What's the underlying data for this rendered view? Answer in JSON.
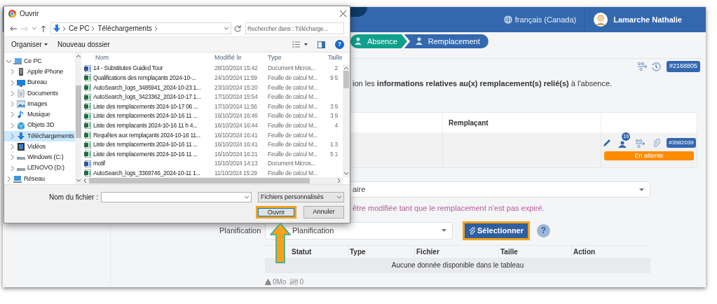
{
  "app": {
    "language": "français (Canada)",
    "user": "Lamarche Nathalie",
    "steps": [
      {
        "label": "Absence",
        "selected": false
      },
      {
        "label": "Remplacement",
        "selected": true
      }
    ],
    "record_id": "#2168805",
    "intro": "ion les **informations relatives au(x) remplacement(s) relié(s)** à l'absence.",
    "replacements": {
      "columns": [
        "Remplaçant"
      ],
      "row": {
        "candidates": "19",
        "id": "#3982039",
        "status": "En attente"
      }
    },
    "reason_select": "aire",
    "warning": "être modifiée tant que le remplacement n'est pas expiré.",
    "planning": {
      "label": "Planification",
      "value": "Planification",
      "button": "Sélectionner",
      "help": "?"
    },
    "files_table": {
      "columns": [
        "Statut",
        "Type",
        "Fichier",
        "Taille",
        "Action"
      ],
      "empty": "Aucune donnée disponible dans le tableau"
    },
    "totals": {
      "size": "0Mo",
      "count": "0"
    }
  },
  "dialog": {
    "title": "Ouvrir",
    "path": [
      "Ce PC",
      "Téléchargements"
    ],
    "search_placeholder": "Rechercher dans : Télécharge...",
    "toolbar": [
      "Organiser",
      "Nouveau dossier"
    ],
    "help": "?",
    "tree": [
      {
        "label": "Ce PC",
        "kind": "pc",
        "expanded": true,
        "selected": false,
        "children": [
          {
            "label": "Apple iPhone",
            "kind": "phone",
            "expanded": false,
            "selected": false
          },
          {
            "label": "Bureau",
            "kind": "desktop",
            "expanded": false,
            "selected": false
          },
          {
            "label": "Documents",
            "kind": "documents",
            "expanded": false,
            "selected": false
          },
          {
            "label": "Images",
            "kind": "images",
            "expanded": false,
            "selected": false
          },
          {
            "label": "Musique",
            "kind": "music",
            "expanded": false,
            "selected": false
          },
          {
            "label": "Objets 3D",
            "kind": "objects3d",
            "expanded": false,
            "selected": false
          },
          {
            "label": "Téléchargements",
            "kind": "download",
            "expanded": false,
            "selected": true
          },
          {
            "label": "Vidéos",
            "kind": "videos",
            "expanded": false,
            "selected": false
          },
          {
            "label": "Windows (C:)",
            "kind": "drive",
            "expanded": false,
            "selected": false
          },
          {
            "label": "LENOVO (D:)",
            "kind": "drive",
            "expanded": false,
            "selected": false
          }
        ]
      },
      {
        "label": "Réseau",
        "kind": "network",
        "expanded": false,
        "selected": false
      }
    ],
    "columns": [
      "Nom",
      "Modifié le",
      "Type",
      "Taille"
    ],
    "files": [
      {
        "kind": "word",
        "name": "14 - Substitutes Guided Tour",
        "modified": "28/10/2024 15:42",
        "type": "Document Micros...",
        "size": "2"
      },
      {
        "kind": "excel",
        "name": "Qualifications des remplaçants 2024-10-...",
        "modified": "24/10/2024 11:59",
        "type": "Feuille de calcul M...",
        "size": "9 5"
      },
      {
        "kind": "excel",
        "name": "AutoSearch_logs_3485941_2024-10-23 1...",
        "modified": "23/10/2024 15:20",
        "type": "Feuille de calcul M..."
      },
      {
        "kind": "excel",
        "name": "AutoSearch_logs_3423362_2024-10-17 1...",
        "modified": "17/10/2024 15:54",
        "type": "Feuille de calcul M..."
      },
      {
        "kind": "excel",
        "name": "Liste des remplacements 2024-10-17 06 ...",
        "modified": "17/10/2024 11:56",
        "type": "Feuille de calcul M...",
        "size": "3 9"
      },
      {
        "kind": "excel",
        "name": "Liste des remplacements 2024-10-16 11 ...",
        "modified": "16/10/2024 16:46",
        "type": "Feuille de calcul M...",
        "size": "3 9"
      },
      {
        "kind": "excel",
        "name": "Liste des remplacants 2024-10-16 11 h 4...",
        "modified": "16/10/2024 16:44",
        "type": "Feuille de calcul M...",
        "size": "4"
      },
      {
        "kind": "excel",
        "name": "Requêtes aux remplaçants 2024-10-16 11...",
        "modified": "16/10/2024 16:41",
        "type": "Feuille de calcul M..."
      },
      {
        "kind": "excel",
        "name": "Liste des remplacements 2024-10-16 11 ...",
        "modified": "16/10/2024 16:41",
        "type": "Feuille de calcul M...",
        "size": "1 3"
      },
      {
        "kind": "excel",
        "name": "Liste des remplacements 2024-10-16 11 ...",
        "modified": "16/10/2024 16:21",
        "type": "Feuille de calcul M...",
        "size": "5 1"
      },
      {
        "kind": "word",
        "name": "motif",
        "modified": "15/10/2024 14:13",
        "type": "Document Micros..."
      },
      {
        "kind": "excel",
        "name": "AutoSearch_logs_3369746_2024-10-11 1...",
        "modified": "11/10/2024 15:29",
        "type": "Feuille de calcul M..."
      }
    ],
    "filename_label": "Nom du fichier :",
    "filetype": "Fichiers personnalisés",
    "buttons": [
      {
        "label": "Ouvrir",
        "highlighted": true
      },
      {
        "label": "Annuler",
        "highlighted": false
      }
    ]
  }
}
